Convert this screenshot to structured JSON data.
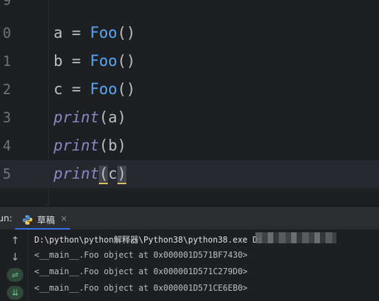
{
  "editor": {
    "lines": [
      {
        "num": "9"
      },
      {
        "num": "0",
        "var": "a",
        "op": " = ",
        "fn": "Foo",
        "open": "(",
        "close": ")"
      },
      {
        "num": "1",
        "var": "b",
        "op": " = ",
        "fn": "Foo",
        "open": "(",
        "close": ")"
      },
      {
        "num": "2",
        "var": "c",
        "op": " = ",
        "fn": "Foo",
        "open": "(",
        "close": ")"
      },
      {
        "num": "3",
        "fn": "print",
        "open": "(",
        "arg": "a",
        "close": ")"
      },
      {
        "num": "4",
        "fn": "print",
        "open": "(",
        "arg": "b",
        "close": ")"
      },
      {
        "num": "5",
        "fn": "print",
        "open": "(",
        "arg": "c",
        "close": ")"
      }
    ]
  },
  "run": {
    "label": "un:",
    "tab_title": "草稿",
    "tab_close": "×",
    "toolbar": {
      "up_icon": "↑",
      "down_icon": "↓",
      "wrap_icon": "⇌",
      "scroll_icon": "⇊"
    },
    "output": [
      "D:\\python\\python解释器\\Python38\\python38.exe D:",
      "<__main__.Foo object at 0x000001D571BF7430>",
      "<__main__.Foo object at 0x000001D571C279D0>",
      "<__main__.Foo object at 0x000001D571CE6EB0>"
    ]
  },
  "colors": {
    "editor_bg": "#1e1f22",
    "function": "#56a8f5",
    "print_builtin": "#8888c6",
    "text": "#bcbec4",
    "accent": "#3574f0"
  }
}
